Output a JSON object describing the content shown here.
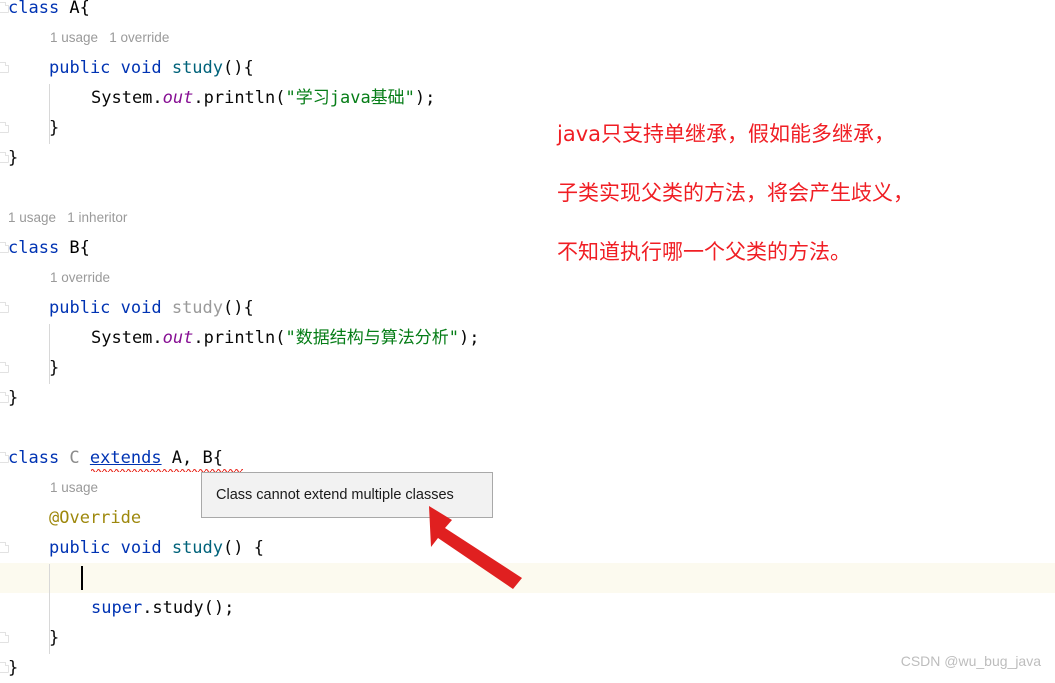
{
  "editor": {
    "background": "#ffffff",
    "caret_line_background": "#fcfaef",
    "colors": {
      "keyword": "#0033b3",
      "string": "#067d17",
      "static_field": "#871094",
      "method": "#00627a",
      "annotation": "#9e880d",
      "dimmed": "#9a9a9a",
      "error_squiggle": "#e8261c",
      "hint_text": "#9a9a9a"
    },
    "lines": [
      {
        "indent": 0,
        "tokens": [
          {
            "text": "class ",
            "style": "kw"
          },
          {
            "text": "A{",
            "style": "cls"
          }
        ]
      },
      {
        "hint": "1 usage   1 override"
      },
      {
        "indent": 1,
        "tokens": [
          {
            "text": "public void ",
            "style": "kw"
          },
          {
            "text": "study",
            "style": "mth"
          },
          {
            "text": "(){",
            "style": "plain"
          }
        ]
      },
      {
        "indent": 2,
        "tokens": [
          {
            "text": "System.",
            "style": "plain"
          },
          {
            "text": "out",
            "style": "fld"
          },
          {
            "text": ".println(",
            "style": "plain"
          },
          {
            "text": "\"学习java基础\"",
            "style": "str"
          },
          {
            "text": ");",
            "style": "plain"
          }
        ]
      },
      {
        "indent": 1,
        "tokens": [
          {
            "text": "}",
            "style": "plain"
          }
        ]
      },
      {
        "indent": 0,
        "tokens": [
          {
            "text": "}",
            "style": "plain"
          }
        ]
      },
      {
        "hint": "1 usage   1 inheritor"
      },
      {
        "indent": 0,
        "tokens": [
          {
            "text": "class ",
            "style": "kw"
          },
          {
            "text": "B{",
            "style": "cls"
          }
        ]
      },
      {
        "hint": "1 override"
      },
      {
        "indent": 1,
        "tokens": [
          {
            "text": "public void ",
            "style": "kw"
          },
          {
            "text": "study",
            "style": "mth-dim"
          },
          {
            "text": "(){",
            "style": "plain"
          }
        ]
      },
      {
        "indent": 2,
        "tokens": [
          {
            "text": "System.",
            "style": "plain"
          },
          {
            "text": "out",
            "style": "fld"
          },
          {
            "text": ".println(",
            "style": "plain"
          },
          {
            "text": "\"数据结构与算法分析\"",
            "style": "str"
          },
          {
            "text": ");",
            "style": "plain"
          }
        ]
      },
      {
        "indent": 1,
        "tokens": [
          {
            "text": "}",
            "style": "plain"
          }
        ]
      },
      {
        "indent": 0,
        "tokens": [
          {
            "text": "}",
            "style": "plain"
          }
        ]
      },
      {
        "indent": 0,
        "tokens": [
          {
            "text": "class ",
            "style": "kw"
          },
          {
            "text": "C ",
            "style": "cls-dim"
          },
          {
            "text": "extends",
            "style": "link"
          },
          {
            "text": " A, B{",
            "style": "plain"
          }
        ]
      },
      {
        "hint": "1 usage"
      },
      {
        "indent": 1,
        "tokens": [
          {
            "text": "@Override",
            "style": "anno"
          }
        ]
      },
      {
        "indent": 1,
        "tokens": [
          {
            "text": "public void ",
            "style": "kw"
          },
          {
            "text": "study",
            "style": "mth"
          },
          {
            "text": "() {",
            "style": "plain"
          }
        ]
      },
      {
        "indent": 2,
        "tokens": []
      },
      {
        "indent": 2,
        "tokens": [
          {
            "text": "super",
            "style": "kw"
          },
          {
            "text": ".study();",
            "style": "plain"
          }
        ]
      },
      {
        "indent": 1,
        "tokens": [
          {
            "text": "}",
            "style": "plain"
          }
        ]
      },
      {
        "indent": 0,
        "tokens": [
          {
            "text": "}",
            "style": "plain"
          }
        ]
      }
    ]
  },
  "code_text": {
    "line_1": "class A{",
    "line_2": "1 usage   1 override",
    "line_3": "public void study(){",
    "line_4": "System.out.println(\"学习java基础\");",
    "line_5": "}",
    "line_6": "}",
    "line_7": "1 usage   1 inheritor",
    "line_8": "class B{",
    "line_9": "1 override",
    "line_10": "public void study(){",
    "line_11": "System.out.println(\"数据结构与算法分析\");",
    "line_12": "}",
    "line_13": "}",
    "line_14": "class C extends A, B{",
    "line_15": "1 usage",
    "line_16": "@Override",
    "line_17": "public void study() {",
    "line_18": "super.study();",
    "line_19": "}",
    "line_20": "}"
  },
  "tooltip": {
    "message": "Class cannot extend multiple classes",
    "background": "#f2f2f2",
    "border_color": "#a9a9a9"
  },
  "annotation": {
    "color": "#f01e24",
    "lines": [
      "java只支持单继承，假如能多继承，",
      "子类实现父类的方法，将会产生歧义，",
      "不知道执行哪一个父类的方法。"
    ]
  },
  "arrow": {
    "color": "#e02020",
    "points_to": "tooltip"
  },
  "watermark": {
    "text": "CSDN @wu_bug_java",
    "color": "#bdbdbd"
  }
}
